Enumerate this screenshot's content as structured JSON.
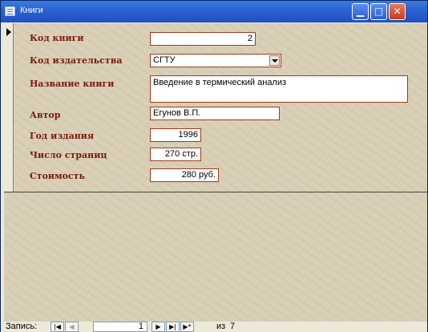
{
  "window": {
    "title": "Книги"
  },
  "form": {
    "fields": [
      {
        "label": "Код книги",
        "value": "2"
      },
      {
        "label": "Код издательства",
        "value": "СГТУ"
      },
      {
        "label": "Название книги",
        "value": "Введение в термический анализ"
      },
      {
        "label": "Автор",
        "value": "Егунов В.П."
      },
      {
        "label": "Год издания",
        "value": "1996"
      },
      {
        "label": "Число страниц",
        "value": "270 стр."
      },
      {
        "label": "Стоимость",
        "value": "280 руб."
      }
    ]
  },
  "navigation": {
    "label": "Запись:",
    "current": "1",
    "of": "из",
    "total": "7",
    "buttons": [
      "first-record-icon",
      "previous-record-icon",
      "next-record-icon",
      "last-record-icon",
      "new-record-icon"
    ]
  },
  "colors": {
    "label": "#7a1a0c",
    "field_border": "#a43a1a",
    "background": "#d8cfb6",
    "titlebar": "#2c64d4"
  }
}
